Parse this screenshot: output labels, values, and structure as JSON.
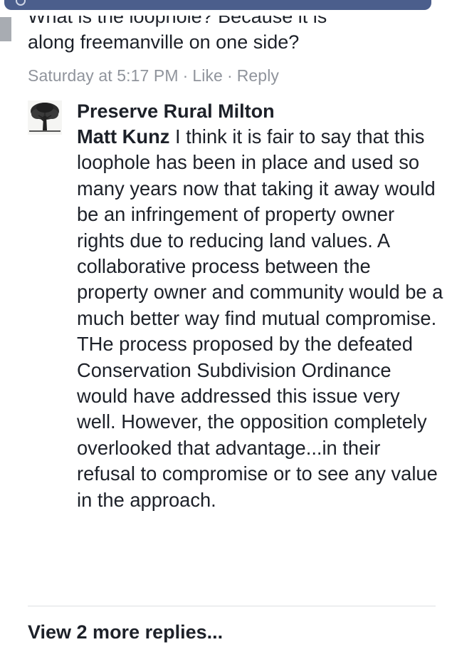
{
  "previous_comment": {
    "text_line1": "What is the loophole? Because it is",
    "text_line2": "along freemanville on one side?",
    "time": "Saturday at 5:17 PM",
    "like_label": "Like",
    "reply_label": "Reply",
    "separator": "·"
  },
  "reply": {
    "author": "Preserve Rural Milton",
    "mention": "Matt Kunz",
    "text": " I think it is fair to say that this loophole has been in place and used so many years now that taking it away would be an infringement of property owner rights due to reducing land values. A collaborative process between the property owner and community would be a much better way find mutual compromise. THe process proposed by the defeated Conservation Subdivision Ordinance would have addressed this issue very well. However, the opposition completely overlooked that advantage...in their refusal to compromise or to see any value in the approach."
  },
  "footer": {
    "more_replies_label": "View 2 more replies..."
  }
}
